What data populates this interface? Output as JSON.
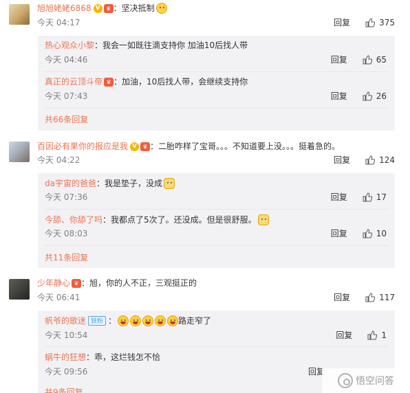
{
  "comments": [
    {
      "user": "旭旭姥姥6868",
      "separator": "：",
      "text": "坚决抵制",
      "time": "今天 04:17",
      "reply_label": "回复",
      "likes": "375",
      "replies": [
        {
          "user": "热心观众小黎",
          "separator": "：",
          "text": "我会一如既往滴支持你 加油10后找人带",
          "time": "今天 04:46",
          "reply_label": "回复",
          "likes": "65"
        },
        {
          "user": "真正的云顶斗帝",
          "separator": "：",
          "text": "加油，10后找人带，会继续支持你",
          "time": "今天 07:43",
          "reply_label": "回复",
          "likes": "26"
        }
      ],
      "more": "共66条回复"
    },
    {
      "user": "百因必有果你的报应是我",
      "separator": "：",
      "text": "二胎咋样了宝哥。。。不知道要上没。。。挺着急的。",
      "time": "今天 04:22",
      "reply_label": "回复",
      "likes": "124",
      "replies": [
        {
          "user": "da宇宙的爸爸",
          "separator": "：",
          "text": "我是垫子，没成",
          "time": "今天 07:36",
          "reply_label": "回复",
          "likes": "17"
        },
        {
          "user": "今舔、你舔了吗",
          "separator": "：",
          "text": "我都点了5次了。还没成。但是很舒服。",
          "time": "今天 08:03",
          "reply_label": "回复",
          "likes": "10"
        }
      ],
      "more": "共11条回复"
    },
    {
      "user": "少年静心",
      "separator": "：",
      "text": "旭，你的人不正，三观挺正的",
      "time": "今天 06:41",
      "reply_label": "回复",
      "likes": "117",
      "replies": [
        {
          "user": "帆爷的歌迷",
          "badge": "铁粉",
          "separator": "：",
          "text": "路走窄了",
          "time": "今天 10:54",
          "reply_label": "回复",
          "likes": "1"
        },
        {
          "user": "蜗牛的狂想",
          "separator": "：",
          "text": "乖，这烂钱怎不恰",
          "time": "今天 09:56",
          "reply_label": "回复",
          "likes": ""
        }
      ],
      "more": "共9条回复"
    }
  ],
  "watermark": "悟空问答",
  "colors": {
    "username": "#eb7350",
    "reply_bg": "#f2f2f5",
    "time": "#808080"
  }
}
